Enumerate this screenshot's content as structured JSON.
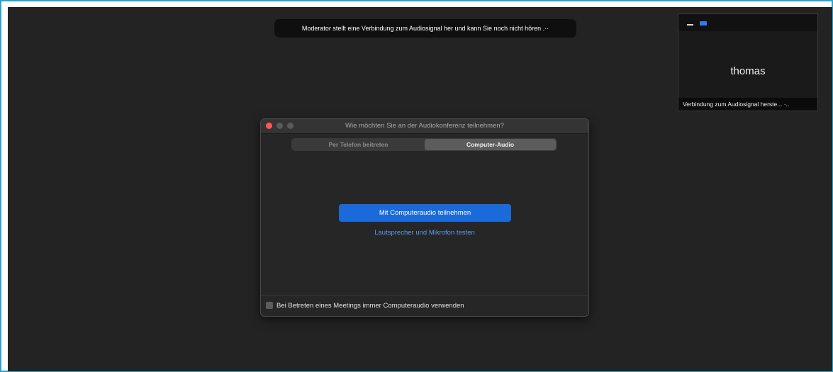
{
  "notification": {
    "text": "Moderator stellt eine Verbindung zum Audiosignal her und kann Sie noch nicht hören .··"
  },
  "thumbnail": {
    "participant_name": "thomas",
    "status": "Verbindung zum Audiosignal herste... ·.."
  },
  "dialog": {
    "title": "Wie möchten Sie an der Audiokonferenz teilnehmen?",
    "tabs": [
      {
        "label": "Per Telefon beitreten",
        "selected": false
      },
      {
        "label": "Computer-Audio",
        "selected": true
      }
    ],
    "join_button_label": "Mit Computeraudio teilnehmen",
    "test_link_label": "Lautsprecher und Mikrofon testen",
    "checkbox": {
      "label": "Bei Betreten eines Meetings immer Computeraudio verwenden",
      "checked": false
    }
  },
  "colors": {
    "accent": "#1b6ad9",
    "link": "#5a9bf0",
    "close": "#fc5753",
    "frame": "#2aa3cf"
  }
}
